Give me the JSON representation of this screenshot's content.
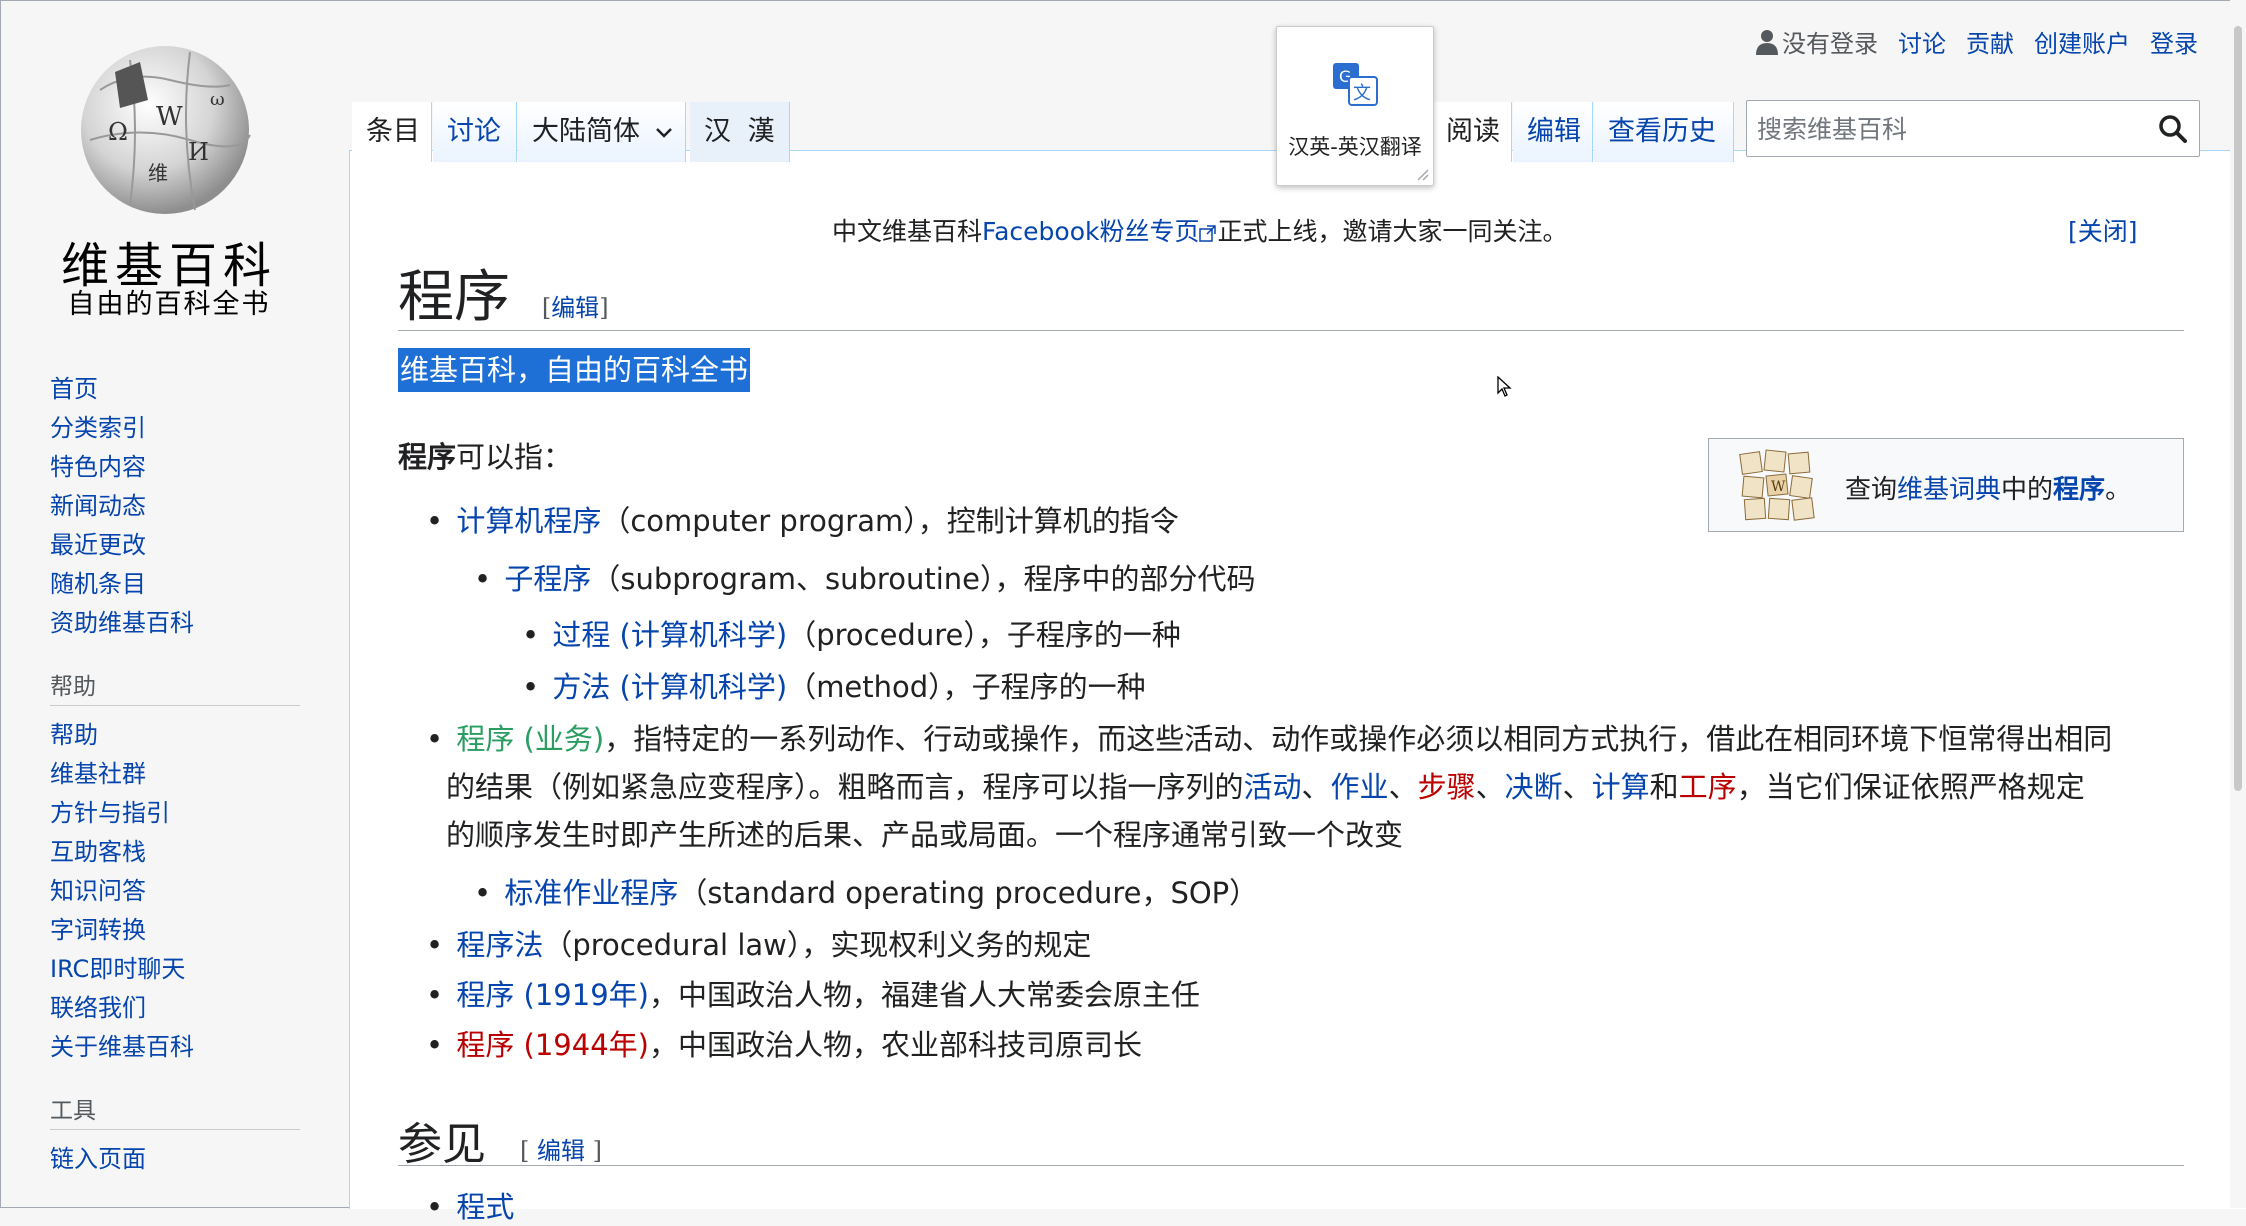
{
  "logo": {
    "title": "维基百科",
    "tagline": "自由的百科全书"
  },
  "sidebar": {
    "nav": [
      "首页",
      "分类索引",
      "特色内容",
      "新闻动态",
      "最近更改",
      "随机条目",
      "资助维基百科"
    ],
    "help_heading": "帮助",
    "help": [
      "帮助",
      "维基社群",
      "方针与指引",
      "互助客栈",
      "知识问答",
      "字词转换",
      "IRC即时聊天",
      "联络我们",
      "关于维基百科"
    ],
    "tools_heading": "工具",
    "tools": [
      "链入页面"
    ]
  },
  "personal": {
    "anon": "没有登录",
    "talk": "讨论",
    "contribs": "贡献",
    "create": "创建账户",
    "login": "登录"
  },
  "tabs": {
    "article": "条目",
    "talk": "讨论",
    "variant": "大陆简体",
    "hanhan": "汉 漢",
    "read": "阅读",
    "edit": "编辑",
    "history": "查看历史"
  },
  "translate_popup": {
    "label": "汉英-英汉翻译"
  },
  "search": {
    "placeholder": "搜索维基百科"
  },
  "notice": {
    "pre": "中文维基百科",
    "link": "Facebook粉丝专页",
    "post": "正式上线，邀请大家一同关注。",
    "close": "[关闭]"
  },
  "page": {
    "title": "程序",
    "edit_open": "[",
    "edit_label": "编辑",
    "edit_close": "]",
    "site_sub": "维基百科，自由的百科全书",
    "intro_bold": "程序",
    "intro_rest": "可以指：",
    "items": {
      "i1_link": "计算机程序",
      "i1_text": "（computer program），控制计算机的指令",
      "i2_link": "子程序",
      "i2_text": "（subprogram、subroutine），程序中的部分代码",
      "i3_link": "过程 (计算机科学)",
      "i3_text": "（procedure），子程序的一种",
      "i4_link": "方法 (计算机科学)",
      "i4_text": "（method），子程序的一种",
      "i5_link": "程序 (业务)",
      "i5_line1": "，指特定的一系列动作、行动或操作，而这些活动、动作或操作必须以相同方式执行，借此在相同环境下恒常得出相同",
      "i5_line2a": "的结果（例如紧急应变程序）。粗略而言，程序可以指一序列的",
      "i5_l_activity": "活动",
      "i5_sep1": "、",
      "i5_l_work": "作业",
      "i5_sep2": "、",
      "i5_l_step": "步骤",
      "i5_sep3": "、",
      "i5_l_decide": "决断",
      "i5_sep4": "、",
      "i5_l_calc": "计算",
      "i5_and": "和",
      "i5_l_proc": "工序",
      "i5_line2b": "，当它们保证依照严格规定",
      "i5_line3": "的顺序发生时即产生所述的后果、产品或局面。一个程序通常引致一个改变",
      "i6_link": "标准作业程序",
      "i6_text": "（standard operating procedure，SOP）",
      "i7_link": "程序法",
      "i7_text": "（procedural law），实现权利义务的规定",
      "i8_link": "程序 (1919年)",
      "i8_text": "，中国政治人物，福建省人大常委会原主任",
      "i9_link": "程序 (1944年)",
      "i9_text": "，中国政治人物，农业部科技司原司长"
    },
    "wiktionary": {
      "pre": "查询",
      "link": "维基词典",
      "mid": "中的",
      "term": "程序",
      "post": "。"
    },
    "see_also": {
      "title": "参见",
      "edit_open": "[ ",
      "edit_label": "编辑",
      "edit_close": " ]",
      "first": "程式"
    }
  }
}
